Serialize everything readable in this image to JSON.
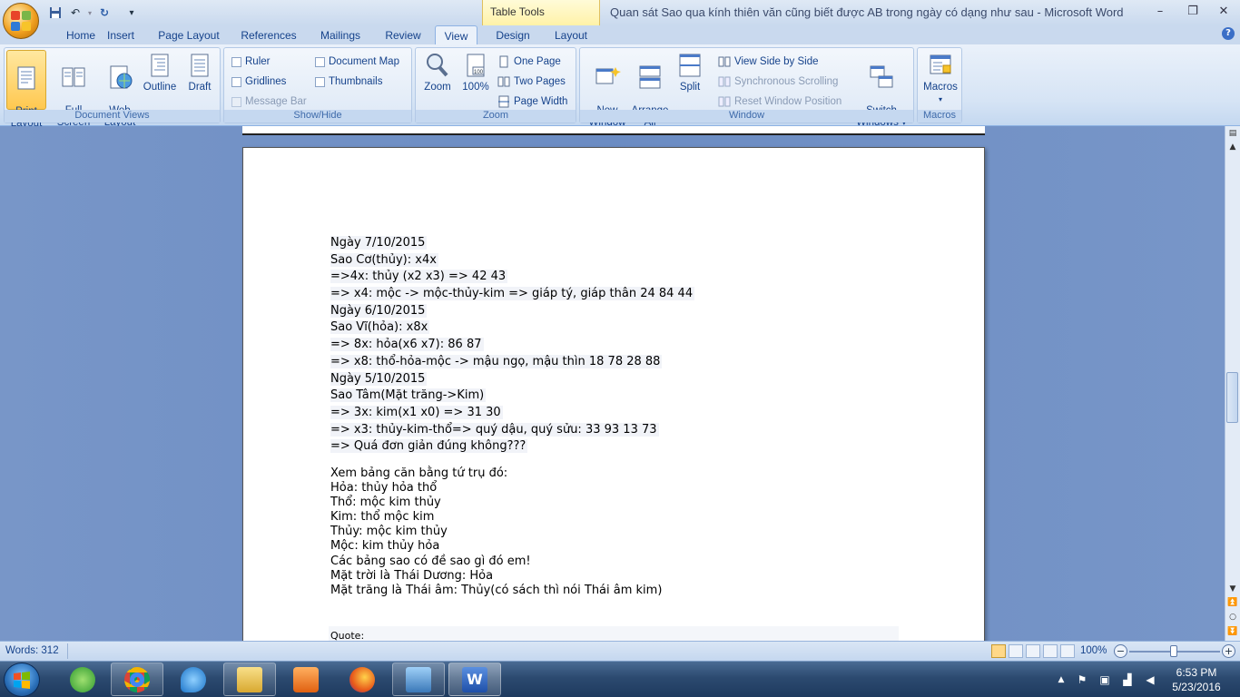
{
  "window": {
    "title": "Quan sát Sao qua kính thiên văn cũng biết được AB trong ngày có dạng như sau - Microsoft Word",
    "contextual_tab": "Table Tools",
    "controls": [
      "–",
      "❐",
      "✕"
    ]
  },
  "tabs": [
    {
      "label": "Home"
    },
    {
      "label": "Insert"
    },
    {
      "label": "Page Layout"
    },
    {
      "label": "References"
    },
    {
      "label": "Mailings"
    },
    {
      "label": "Review"
    },
    {
      "label": "View"
    },
    {
      "label": "Design"
    },
    {
      "label": "Layout"
    }
  ],
  "ribbon": {
    "document_views": {
      "label": "Document Views",
      "print_layout": "Print\nLayout",
      "full_screen": "Full Screen\nReading",
      "web_layout": "Web\nLayout",
      "outline": "Outline",
      "draft": "Draft"
    },
    "show_hide": {
      "label": "Show/Hide",
      "ruler": "Ruler",
      "gridlines": "Gridlines",
      "message_bar": "Message Bar",
      "document_map": "Document Map",
      "thumbnails": "Thumbnails"
    },
    "zoom": {
      "label": "Zoom",
      "zoom": "Zoom",
      "hundred": "100%",
      "one_page": "One Page",
      "two_pages": "Two Pages",
      "page_width": "Page Width"
    },
    "window": {
      "label": "Window",
      "new_window": "New\nWindow",
      "arrange_all": "Arrange\nAll",
      "split": "Split",
      "side_by_side": "View Side by Side",
      "sync_scroll": "Synchronous Scrolling",
      "reset_pos": "Reset Window Position",
      "switch_windows": "Switch\nWindows ▾"
    },
    "macros": {
      "label": "Macros",
      "macros": "Macros"
    }
  },
  "document": {
    "block1": [
      "Ngày 7/10/2015",
      "Sao Cơ(thủy): x4x",
      "=>4x: thủy (x2 x3) => 42 43",
      "=> x4: mộc -> mộc-thủy-kim => giáp tý, giáp thân 24 84 44",
      "Ngày 6/10/2015",
      "Sao Vĩ(hỏa): x8x",
      "=> 8x: hỏa(x6 x7): 86 87",
      "=> x8: thổ-hỏa-mộc -> mậu ngọ, mậu thìn 18 78 28 88",
      "Ngày 5/10/2015",
      "Sao Tâm(Mặt trăng->Kim)",
      "=> 3x: kim(x1 x0) => 31 30",
      "=> x3: thủy-kim-thổ=>  quý dậu, quý sửu: 33 93 13 73",
      "=> Quá đơn giản đúng không???"
    ],
    "block2": [
      "Xem bảng căn bằng tứ trụ đó:",
      "Hỏa: thủy hỏa thổ",
      "Thổ: mộc kim thủy",
      "Kim: thổ mộc kim",
      "Thủy: mộc kim thủy",
      "Mộc: kim thủy hỏa",
      "Các bảng sao có đề sao gì đó em!",
      "Mặt trời là Thái Dương: Hỏa",
      "Mặt trăng là Thái âm: Thủy(có sách thì nói Thái  âm kim)"
    ],
    "quote_label": "Quote:"
  },
  "statusbar": {
    "words": "Words: 312",
    "zoom": "100%",
    "zoom_minus": "−",
    "zoom_plus": "+",
    "zoom_fraction": 0.5
  },
  "taskbar": {
    "time": "6:53 PM",
    "date": "5/23/2016"
  },
  "colors": {
    "accent": "#15428b",
    "ribbon_active": "#ffc850",
    "doc_background": "#6b8cc3"
  }
}
